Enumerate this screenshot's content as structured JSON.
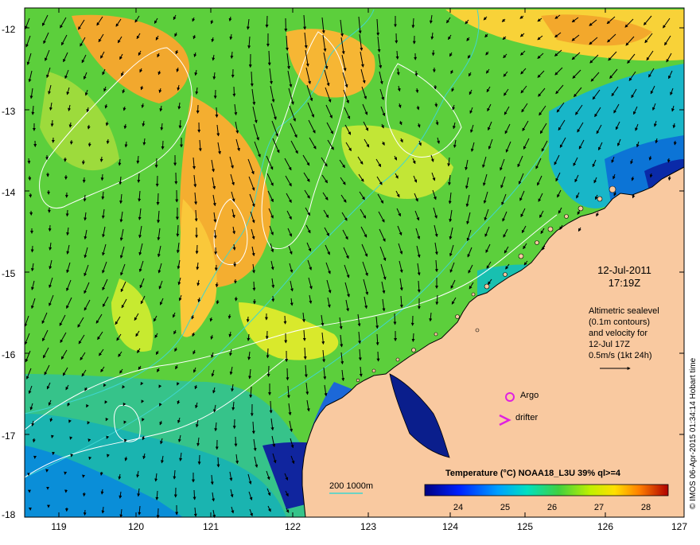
{
  "map": {
    "y_ticks": [
      "-12",
      "-13",
      "-14",
      "-15",
      "-16",
      "-17",
      "-18"
    ],
    "x_ticks": [
      "119",
      "120",
      "121",
      "122",
      "123",
      "124",
      "125",
      "126",
      "127"
    ],
    "date": "12-Jul-2011",
    "time": "17:19Z",
    "legend_lines": [
      "Altimetric sealevel",
      "(0.1m contours)",
      "and velocity for",
      "12-Jul 17Z",
      "0.5m/s (1kt 24h)"
    ],
    "argo_label": "Argo",
    "drifter_label": "drifter",
    "bathy_label": "200  1000m",
    "colorbar_title": "Temperature (°C) NOAA18_L3U 39% ql>=4",
    "colorbar_ticks": [
      "24",
      "25",
      "26",
      "27",
      "28"
    ],
    "credit": "© IMOS 06-Apr-2015 01:34:14 Hobart time",
    "colors": {
      "land": "#f9c9a0",
      "contour": "#ffffff",
      "bathy_line": "#3fd6d0",
      "argo": "#e020e0",
      "drifter": "#e020e0"
    }
  }
}
